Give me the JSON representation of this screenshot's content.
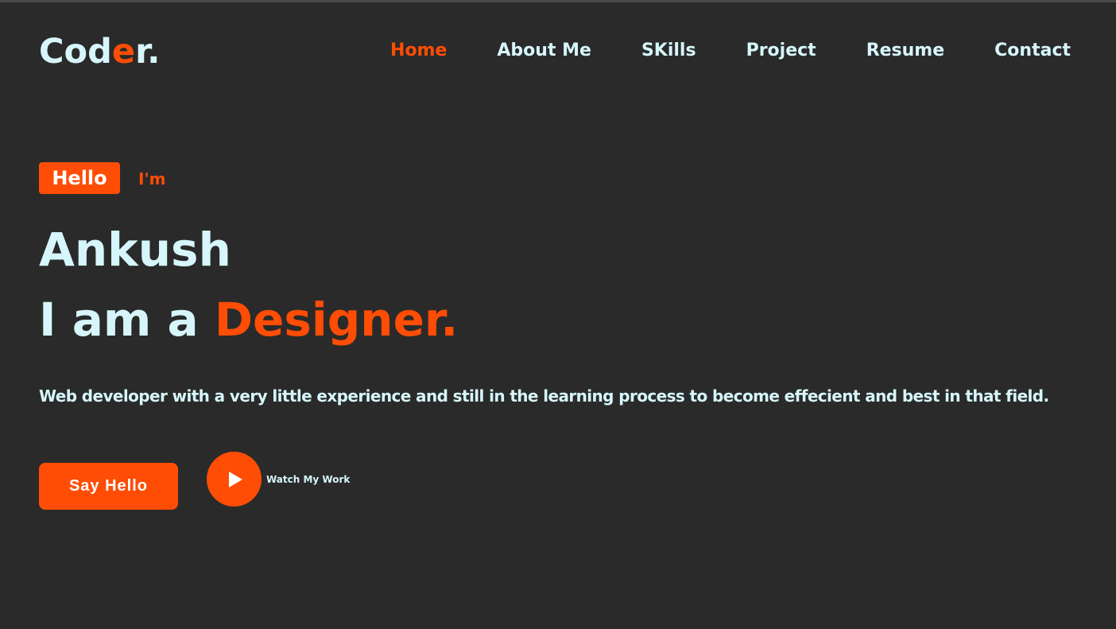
{
  "header": {
    "logo": {
      "part1": "Cod",
      "accent": "e",
      "part2": "r."
    },
    "nav": [
      {
        "label": "Home",
        "active": true
      },
      {
        "label": "About Me",
        "active": false
      },
      {
        "label": "SKills",
        "active": false
      },
      {
        "label": "Project",
        "active": false
      },
      {
        "label": "Resume",
        "active": false
      },
      {
        "label": "Contact",
        "active": false
      }
    ]
  },
  "hero": {
    "badge": "Hello",
    "intro": "I'm",
    "name": "Ankush",
    "role_prefix": "I am a ",
    "role_word": "Designer.",
    "description": "Web developer with a very little experience and still in the learning process to become effecient and best in that field.",
    "cta_label": "Say Hello",
    "watch_label": "Watch My Work",
    "play_icon": "play-icon"
  },
  "colors": {
    "background": "#2a2a2a",
    "accent": "#ff4d05",
    "text": "#d6f6fb"
  }
}
